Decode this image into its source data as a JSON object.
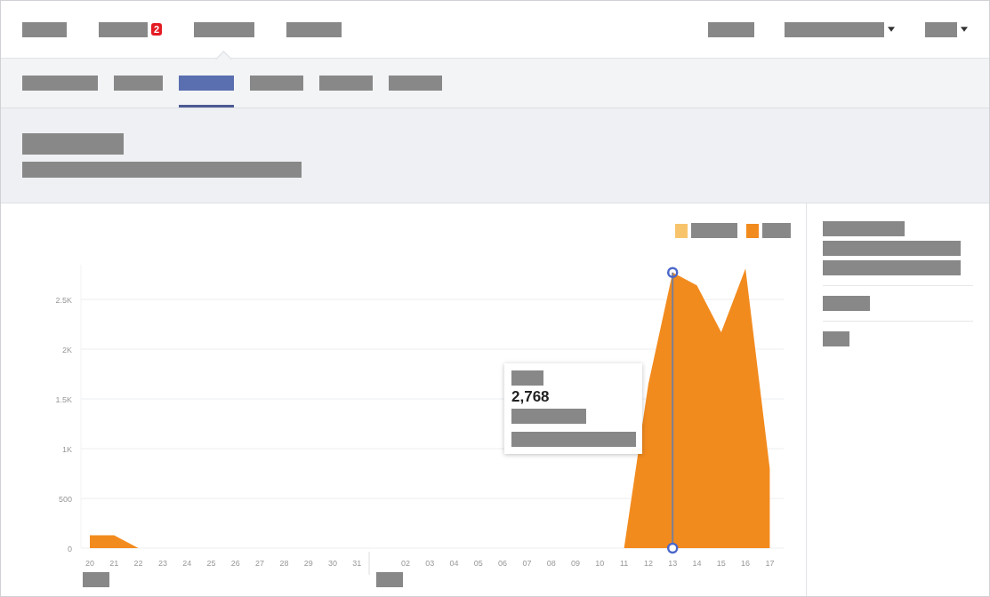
{
  "top_nav": {
    "left": [
      {
        "selected": false
      },
      {
        "selected": false,
        "badge": "2"
      },
      {
        "selected": true
      },
      {
        "selected": false
      }
    ],
    "right": [
      {
        "dropdown": false
      },
      {
        "dropdown": true
      },
      {
        "dropdown": true
      }
    ]
  },
  "sub_nav": [
    {
      "selected": false
    },
    {
      "selected": false
    },
    {
      "selected": true
    },
    {
      "selected": false
    },
    {
      "selected": false
    },
    {
      "selected": false
    }
  ],
  "chart_panel": {
    "tooltip": {
      "value": "2,768"
    },
    "chart_data": {
      "type": "area",
      "categories": [
        "20",
        "21",
        "22",
        "23",
        "24",
        "25",
        "26",
        "27",
        "28",
        "29",
        "30",
        "31",
        null,
        "02",
        "03",
        "04",
        "05",
        "06",
        "07",
        "08",
        "09",
        "10",
        "11",
        "12",
        "13",
        "14",
        "15",
        "16",
        "17"
      ],
      "yticks": [
        {
          "value": 0,
          "label": "0"
        },
        {
          "value": 500,
          "label": "500"
        },
        {
          "value": 1000,
          "label": "1K"
        },
        {
          "value": 1500,
          "label": "1.5K"
        },
        {
          "value": 2000,
          "label": "2K"
        },
        {
          "value": 2500,
          "label": "2.5K"
        }
      ],
      "grid": true,
      "ylim": [
        0,
        2850
      ],
      "series": [
        {
          "color": "#f7c46c",
          "values": [
            null,
            null,
            null,
            null,
            null,
            null,
            null,
            null,
            null,
            null,
            null,
            null,
            null,
            null,
            null,
            null,
            null,
            null,
            null,
            null,
            null,
            null,
            null,
            null,
            null,
            null,
            null,
            null,
            null
          ]
        },
        {
          "color": "#f28b1e",
          "values": [
            130,
            130,
            0,
            0,
            0,
            0,
            0,
            0,
            0,
            0,
            0,
            0,
            0,
            0,
            0,
            0,
            0,
            0,
            0,
            0,
            0,
            0,
            0,
            1650,
            2770,
            2640,
            2170,
            2810,
            800
          ]
        }
      ]
    }
  }
}
